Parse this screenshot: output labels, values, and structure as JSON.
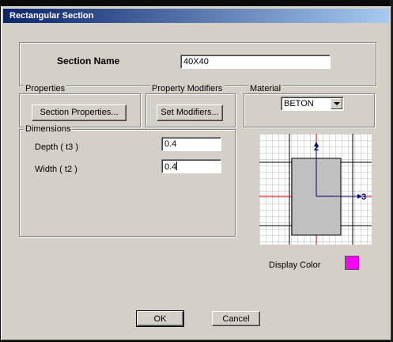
{
  "dialog": {
    "title": "Rectangular Section",
    "section_name_label": "Section Name",
    "section_name_value": "40X40",
    "properties": {
      "group_label": "Properties",
      "button_label": "Section Properties..."
    },
    "property_modifiers": {
      "group_label": "Property Modifiers",
      "button_label": "Set Modifiers..."
    },
    "material": {
      "group_label": "Material",
      "selected": "BETON"
    },
    "dimensions": {
      "group_label": "Dimensions",
      "depth_label": "Depth ( t3 )",
      "depth_value": "0.4",
      "width_label": "Width ( t2 )",
      "width_value": "0.4"
    },
    "preview": {
      "axis_2_label": "2",
      "axis_3_label": "3"
    },
    "display_color": {
      "label": "Display Color",
      "color": "#ff00ff"
    },
    "ok_label": "OK",
    "cancel_label": "Cancel"
  }
}
